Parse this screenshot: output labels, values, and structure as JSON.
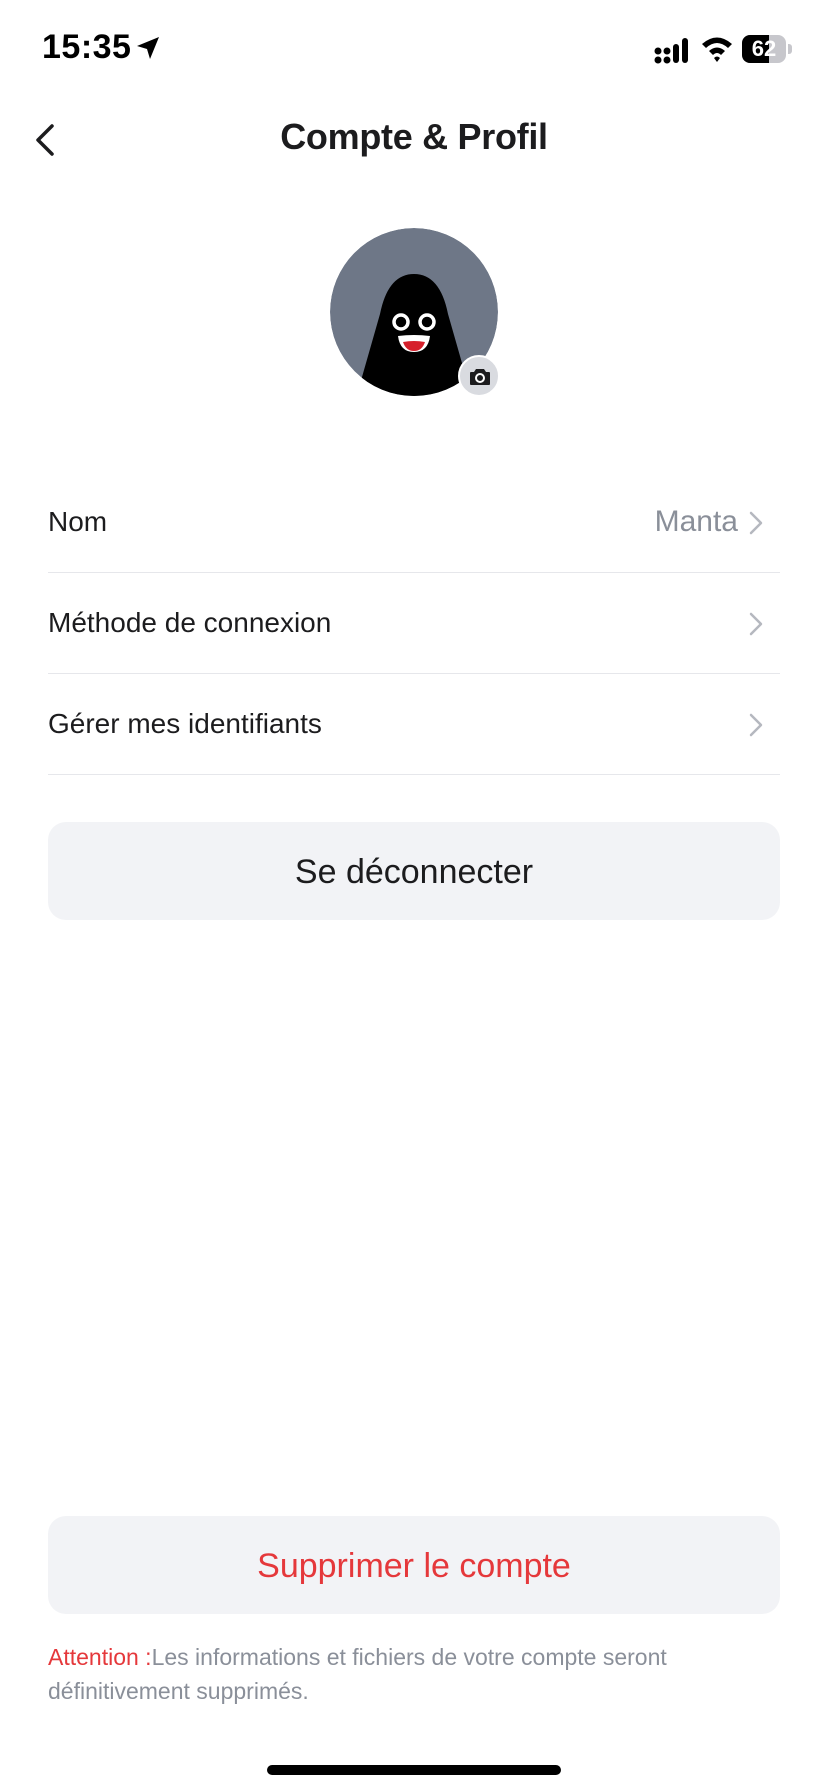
{
  "status_bar": {
    "time": "15:35",
    "battery_level": "62",
    "battery_fraction": 0.62,
    "location_icon": "location-arrow-icon",
    "signal_icon": "cellular-signal-icon",
    "wifi_icon": "wifi-icon"
  },
  "header": {
    "title": "Compte & Profil",
    "back_icon": "chevron-left-icon"
  },
  "avatar": {
    "background_color": "#6e7787",
    "badge_icon": "camera-icon"
  },
  "settings": {
    "items": [
      {
        "label": "Nom",
        "value": "Manta"
      },
      {
        "label": "Méthode de connexion",
        "value": ""
      },
      {
        "label": "Gérer mes identifiants",
        "value": ""
      }
    ]
  },
  "actions": {
    "logout_label": "Se déconnecter",
    "delete_label": "Supprimer le compte"
  },
  "warning": {
    "prefix": "Attention :",
    "text": "Les informations et fichiers de votre compte seront définitivement supprimés."
  },
  "colors": {
    "danger": "#e5383b",
    "secondary_text": "#8a8f99",
    "button_bg": "#f2f3f6"
  }
}
